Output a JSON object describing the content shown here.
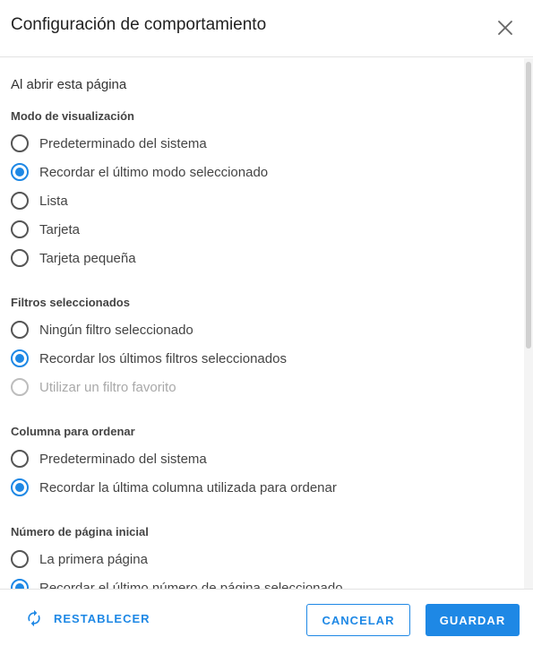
{
  "dialog": {
    "title": "Configuración de comportamiento",
    "close_icon": "close-icon"
  },
  "content": {
    "section_title": "Al abrir esta página",
    "groups": [
      {
        "title": "Modo de visualización",
        "options": [
          {
            "label": "Predeterminado del sistema",
            "checked": false,
            "disabled": false
          },
          {
            "label": "Recordar el último modo seleccionado",
            "checked": true,
            "disabled": false
          },
          {
            "label": "Lista",
            "checked": false,
            "disabled": false
          },
          {
            "label": "Tarjeta",
            "checked": false,
            "disabled": false
          },
          {
            "label": "Tarjeta pequeña",
            "checked": false,
            "disabled": false
          }
        ]
      },
      {
        "title": "Filtros seleccionados",
        "options": [
          {
            "label": "Ningún filtro seleccionado",
            "checked": false,
            "disabled": false
          },
          {
            "label": "Recordar los últimos filtros seleccionados",
            "checked": true,
            "disabled": false
          },
          {
            "label": "Utilizar un filtro favorito",
            "checked": false,
            "disabled": true
          }
        ]
      },
      {
        "title": "Columna para ordenar",
        "options": [
          {
            "label": "Predeterminado del sistema",
            "checked": false,
            "disabled": false
          },
          {
            "label": "Recordar la última columna utilizada para ordenar",
            "checked": true,
            "disabled": false
          }
        ]
      },
      {
        "title": "Número de página inicial",
        "options": [
          {
            "label": "La primera página",
            "checked": false,
            "disabled": false
          },
          {
            "label": "Recordar el último número de página seleccionado",
            "checked": true,
            "disabled": false
          }
        ]
      }
    ]
  },
  "footer": {
    "reset_label": "RESTABLECER",
    "reset_icon": "refresh-icon",
    "cancel_label": "CANCELAR",
    "save_label": "GUARDAR"
  },
  "colors": {
    "accent": "#1e88e5",
    "text": "#444444",
    "disabled": "#a9a9a9"
  }
}
